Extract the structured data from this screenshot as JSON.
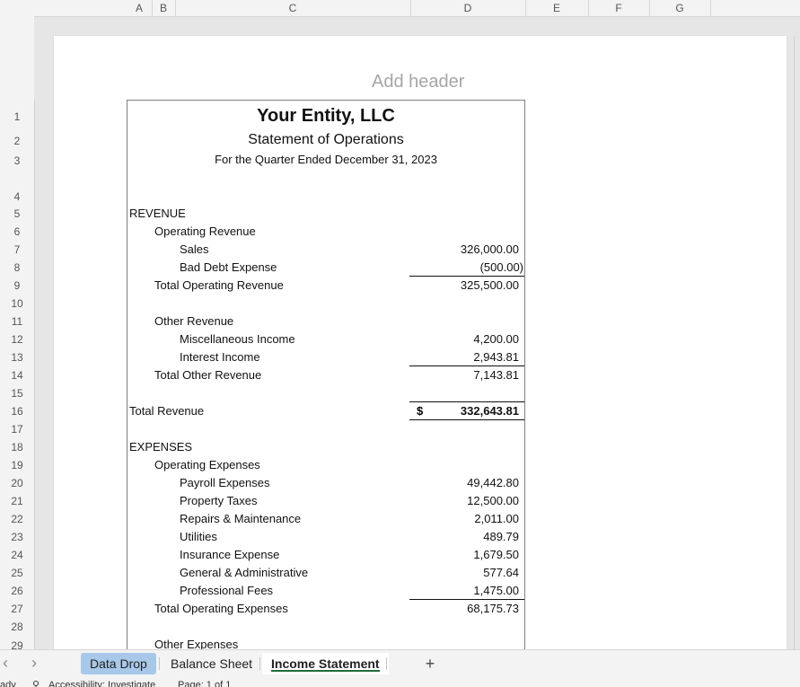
{
  "columns": [
    "A",
    "B",
    "C",
    "D",
    "E",
    "F",
    "G"
  ],
  "rows": [
    "1",
    "2",
    "3",
    "4",
    "5",
    "6",
    "7",
    "8",
    "9",
    "10",
    "11",
    "12",
    "13",
    "14",
    "15",
    "16",
    "17",
    "18",
    "19",
    "20",
    "21",
    "22",
    "23",
    "24",
    "25",
    "26",
    "27",
    "28",
    "29"
  ],
  "page": {
    "header_placeholder": "Add header"
  },
  "report": {
    "entity": "Your Entity, LLC",
    "statement": "Statement of Operations",
    "period": "For the Quarter Ended December 31, 2023",
    "revenue_label": "REVENUE",
    "operating_revenue_label": "Operating Revenue",
    "sales_label": "Sales",
    "sales": "326,000.00",
    "bad_debt_label": "Bad Debt Expense",
    "bad_debt": "(500.00)",
    "total_operating_revenue_label": "Total Operating Revenue",
    "total_operating_revenue": "325,500.00",
    "other_revenue_label": "Other Revenue",
    "misc_income_label": "Miscellaneous Income",
    "misc_income": "4,200.00",
    "interest_income_label": "Interest Income",
    "interest_income": "2,943.81",
    "total_other_revenue_label": "Total Other Revenue",
    "total_other_revenue": "7,143.81",
    "total_revenue_label": "Total Revenue",
    "currency_symbol": "$",
    "total_revenue": "332,643.81",
    "expenses_label": "EXPENSES",
    "operating_expenses_label": "Operating Expenses",
    "payroll_label": "Payroll Expenses",
    "payroll": "49,442.80",
    "property_taxes_label": "Property Taxes",
    "property_taxes": "12,500.00",
    "repairs_label": "Repairs & Maintenance",
    "repairs": "2,011.00",
    "utilities_label": "Utilities",
    "utilities": "489.79",
    "insurance_label": "Insurance Expense",
    "insurance": "1,679.50",
    "ga_label": "General & Administrative",
    "ga": "577.64",
    "professional_label": "Professional Fees",
    "professional": "1,475.00",
    "total_operating_expenses_label": "Total Operating Expenses",
    "total_operating_expenses": "68,175.73",
    "other_expenses_label": "Other Expenses"
  },
  "tabs": {
    "data_drop": "Data Drop",
    "balance_sheet": "Balance Sheet",
    "income_statement": "Income Statement",
    "add": "+"
  },
  "nav": {
    "prev": "‹",
    "next": "›"
  },
  "status": {
    "ready": "ady",
    "accessibility": "Accessibility: Investigate",
    "page": "Page: 1 of 1"
  }
}
